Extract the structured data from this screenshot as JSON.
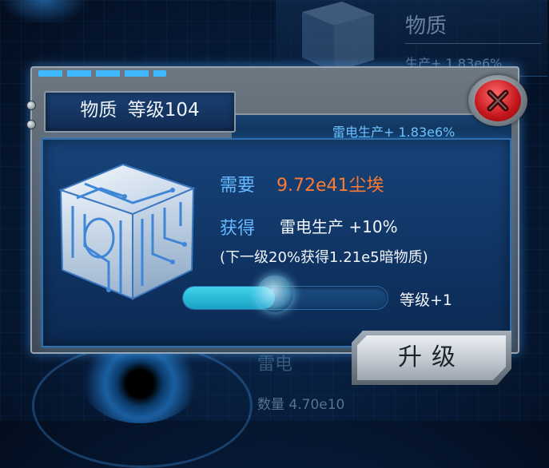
{
  "background": {
    "card_title": "物质",
    "card_rate": "生产+ 1.83e6%",
    "bottom_label": "雷电",
    "count": "数量 4.70e10"
  },
  "modal": {
    "title_name": "物质",
    "title_level": "等级104",
    "header_rate": "雷电生产+ 1.83e6%",
    "need_label": "需要",
    "need_value": "9.72e41尘埃",
    "gain_label": "获得",
    "gain_value": "雷电生产 +10%",
    "next_note": "(下一级20%获得1.21e5暗物质)",
    "slider_fraction": 0.45,
    "slider_label": "等级+1",
    "upgrade_label": "升级"
  },
  "colors": {
    "accent_blue": "#66b9ff",
    "cost_orange": "#ff7a2f",
    "close_red": "#c3151b",
    "slider_cyan": "#3fd4ea"
  },
  "icons": {
    "close": "close-x-icon",
    "cube": "matter-cube-icon"
  }
}
